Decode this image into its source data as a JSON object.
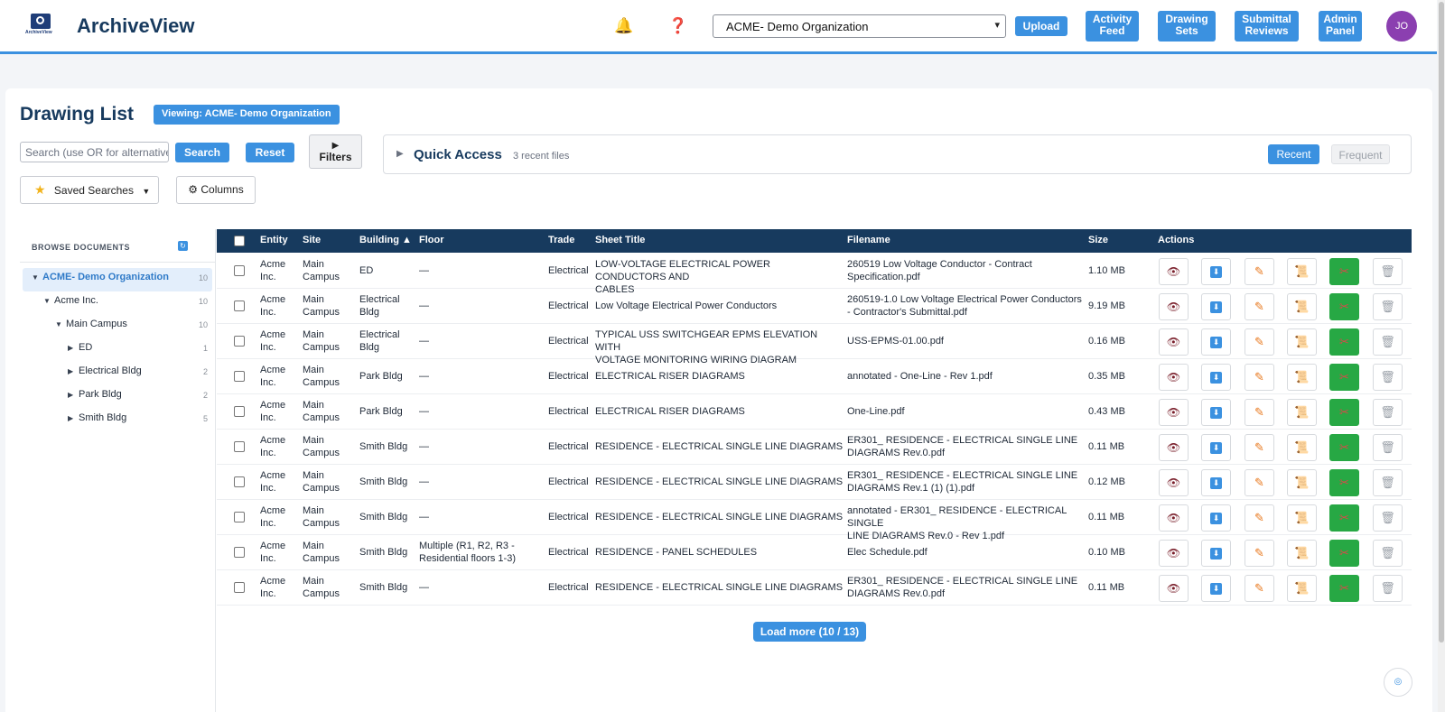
{
  "header": {
    "brand": "ArchiveView",
    "logo_text": "ArchiveView",
    "org_selected": "ACME- Demo Organization",
    "buttons": {
      "upload": "Upload",
      "activity": [
        "Activity",
        "Feed"
      ],
      "drawing_sets": [
        "Drawing",
        "Sets"
      ],
      "submittal": [
        "Submittal",
        "Reviews"
      ],
      "admin": [
        "Admin",
        "Panel"
      ]
    },
    "avatar_initials": "JO"
  },
  "page": {
    "title": "Drawing List",
    "viewing_badge": "Viewing: ACME- Demo Organization",
    "search_placeholder": "Search (use OR for alternatives)",
    "search_label": "Search",
    "reset_label": "Reset",
    "filters_icon": "▶",
    "filters_label": "Filters",
    "saved_searches_label": "Saved Searches",
    "columns_label": "⚙ Columns",
    "quick_access": {
      "title": "Quick Access",
      "subtitle": "3 recent files",
      "recent_label": "Recent",
      "frequent_label": "Frequent"
    },
    "load_more": "Load more (10 / 13)"
  },
  "sidebar": {
    "header": "BROWSE DOCUMENTS",
    "tree": [
      {
        "label": "ACME- Demo Organization",
        "count": "10",
        "level": 0,
        "expanded": true,
        "selected": true
      },
      {
        "label": "Acme Inc.",
        "count": "10",
        "level": 1,
        "expanded": true
      },
      {
        "label": "Main Campus",
        "count": "10",
        "level": 2,
        "expanded": true
      },
      {
        "label": "ED",
        "count": "1",
        "level": 3,
        "expanded": false
      },
      {
        "label": "Electrical Bldg",
        "count": "2",
        "level": 3,
        "expanded": false
      },
      {
        "label": "Park Bldg",
        "count": "2",
        "level": 3,
        "expanded": false
      },
      {
        "label": "Smith Bldg",
        "count": "5",
        "level": 3,
        "expanded": false
      }
    ]
  },
  "table": {
    "columns": [
      "Entity",
      "Site",
      "Building ▲",
      "Floor",
      "Trade",
      "Sheet Title",
      "Filename",
      "Size",
      "Actions"
    ],
    "rows": [
      {
        "entity": [
          "Acme",
          "Inc."
        ],
        "site": [
          "Main",
          "Campus"
        ],
        "building": [
          "ED"
        ],
        "floor": [
          "—"
        ],
        "trade": "Electrical",
        "title": [
          "LOW-VOLTAGE ELECTRICAL POWER CONDUCTORS AND",
          "CABLES"
        ],
        "filename": [
          "260519 Low Voltage Conductor - Contract",
          "Specification.pdf"
        ],
        "size": "1.10 MB"
      },
      {
        "entity": [
          "Acme",
          "Inc."
        ],
        "site": [
          "Main",
          "Campus"
        ],
        "building": [
          "Electrical",
          "Bldg"
        ],
        "floor": [
          "—"
        ],
        "trade": "Electrical",
        "title": [
          "Low Voltage Electrical Power Conductors"
        ],
        "filename": [
          "260519-1.0 Low Voltage Electrical Power Conductors",
          "- Contractor's Submittal.pdf"
        ],
        "size": "9.19 MB"
      },
      {
        "entity": [
          "Acme",
          "Inc."
        ],
        "site": [
          "Main",
          "Campus"
        ],
        "building": [
          "Electrical",
          "Bldg"
        ],
        "floor": [
          "—"
        ],
        "trade": "Electrical",
        "title": [
          "TYPICAL USS SWITCHGEAR EPMS ELEVATION WITH",
          "VOLTAGE MONITORING WIRING DIAGRAM"
        ],
        "filename": [
          "USS-EPMS-01.00.pdf"
        ],
        "size": "0.16 MB"
      },
      {
        "entity": [
          "Acme",
          "Inc."
        ],
        "site": [
          "Main",
          "Campus"
        ],
        "building": [
          "Park Bldg"
        ],
        "floor": [
          "—"
        ],
        "trade": "Electrical",
        "title": [
          "ELECTRICAL RISER DIAGRAMS"
        ],
        "filename": [
          "annotated - One-Line - Rev 1.pdf"
        ],
        "size": "0.35 MB"
      },
      {
        "entity": [
          "Acme",
          "Inc."
        ],
        "site": [
          "Main",
          "Campus"
        ],
        "building": [
          "Park Bldg"
        ],
        "floor": [
          "—"
        ],
        "trade": "Electrical",
        "title": [
          "ELECTRICAL RISER DIAGRAMS"
        ],
        "filename": [
          "One-Line.pdf"
        ],
        "size": "0.43 MB"
      },
      {
        "entity": [
          "Acme",
          "Inc."
        ],
        "site": [
          "Main",
          "Campus"
        ],
        "building": [
          "Smith Bldg"
        ],
        "floor": [
          "—"
        ],
        "trade": "Electrical",
        "title": [
          "RESIDENCE - ELECTRICAL SINGLE LINE DIAGRAMS"
        ],
        "filename": [
          "ER301_ RESIDENCE - ELECTRICAL SINGLE LINE",
          "DIAGRAMS Rev.0.pdf"
        ],
        "size": "0.11 MB"
      },
      {
        "entity": [
          "Acme",
          "Inc."
        ],
        "site": [
          "Main",
          "Campus"
        ],
        "building": [
          "Smith Bldg"
        ],
        "floor": [
          "—"
        ],
        "trade": "Electrical",
        "title": [
          "RESIDENCE - ELECTRICAL SINGLE LINE DIAGRAMS"
        ],
        "filename": [
          "ER301_ RESIDENCE - ELECTRICAL SINGLE LINE",
          "DIAGRAMS Rev.1 (1) (1).pdf"
        ],
        "size": "0.12 MB"
      },
      {
        "entity": [
          "Acme",
          "Inc."
        ],
        "site": [
          "Main",
          "Campus"
        ],
        "building": [
          "Smith Bldg"
        ],
        "floor": [
          "—"
        ],
        "trade": "Electrical",
        "title": [
          "RESIDENCE - ELECTRICAL SINGLE LINE DIAGRAMS"
        ],
        "filename": [
          "annotated - ER301_ RESIDENCE - ELECTRICAL SINGLE",
          "LINE DIAGRAMS Rev.0 - Rev 1.pdf"
        ],
        "size": "0.11 MB"
      },
      {
        "entity": [
          "Acme",
          "Inc."
        ],
        "site": [
          "Main",
          "Campus"
        ],
        "building": [
          "Smith Bldg"
        ],
        "floor": [
          "Multiple (R1, R2, R3 -",
          "Residential floors 1-3)"
        ],
        "trade": "Electrical",
        "title": [
          "RESIDENCE - PANEL SCHEDULES"
        ],
        "filename": [
          "Elec Schedule.pdf"
        ],
        "size": "0.10 MB"
      },
      {
        "entity": [
          "Acme",
          "Inc."
        ],
        "site": [
          "Main",
          "Campus"
        ],
        "building": [
          "Smith Bldg"
        ],
        "floor": [
          "—"
        ],
        "trade": "Electrical",
        "title": [
          "RESIDENCE - ELECTRICAL SINGLE LINE DIAGRAMS"
        ],
        "filename": [
          "ER301_ RESIDENCE - ELECTRICAL SINGLE LINE",
          "DIAGRAMS Rev.0.pdf"
        ],
        "size": "0.11 MB"
      }
    ],
    "actions": [
      {
        "name": "view-icon",
        "glyph": "👁",
        "cls": "eye"
      },
      {
        "name": "download-icon",
        "glyph": "⬇",
        "cls": "dl"
      },
      {
        "name": "edit-icon",
        "glyph": "✎",
        "cls": "pen"
      },
      {
        "name": "history-icon",
        "glyph": "📜",
        "cls": "scroll"
      },
      {
        "name": "tools-icon",
        "glyph": "✂",
        "cls": "tools green"
      },
      {
        "name": "delete-icon",
        "glyph": "🗑",
        "cls": "trash"
      }
    ]
  },
  "colors": {
    "primary": "#3b91e0",
    "navy": "#173a5e",
    "green": "#27a844",
    "avatar": "#8b3fb0"
  }
}
